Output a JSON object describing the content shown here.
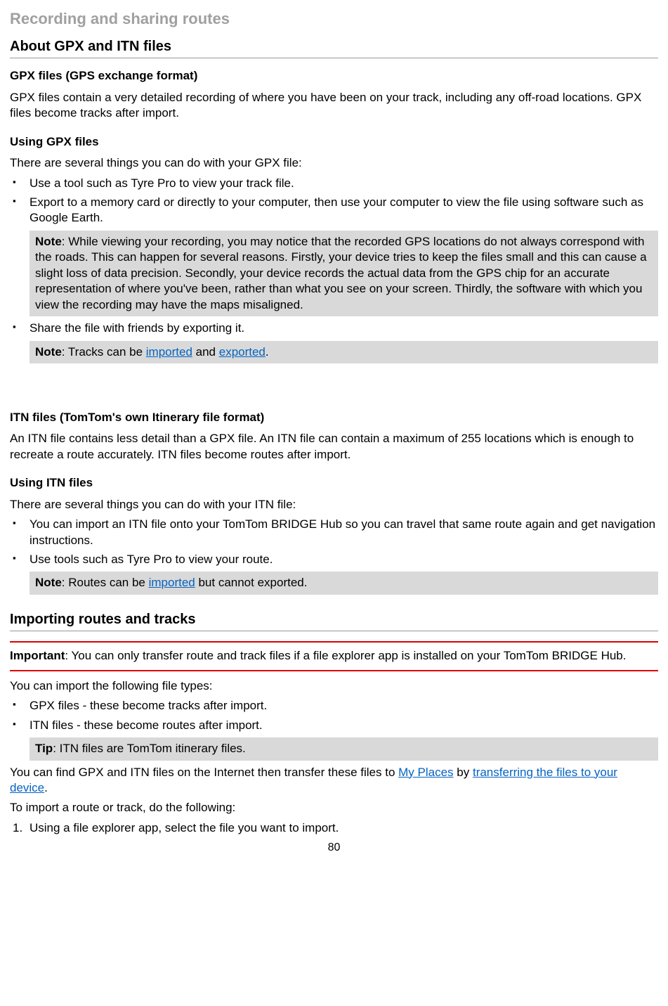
{
  "section_title": "Recording and sharing routes",
  "subsection_about": "About GPX and ITN files",
  "gpx": {
    "title": "GPX files (GPS exchange format)",
    "intro": "GPX files contain a very detailed recording of where you have been on your track, including any off-road locations. GPX files become tracks after import.",
    "using_title": "Using GPX files",
    "using_intro": "There are several things you can do with your GPX file:",
    "bullets": [
      "Use a tool such as Tyre Pro to view your track file.",
      "Export to a memory card or directly to your computer, then use your computer to view the file using software such as Google Earth."
    ],
    "note1_label": "Note",
    "note1": ": While viewing your recording, you may notice that the recorded GPS locations do not always correspond with the roads. This can happen for several reasons. Firstly, your device tries to keep the files small and this can cause a slight loss of data precision. Secondly, your device records the actual data from the GPS chip for an accurate representation of where you've been, rather than what you see on your screen. Thirdly, the software with which you view the recording may have the maps misaligned.",
    "bullet3": "Share the file with friends by exporting it.",
    "note2_label": "Note",
    "note2_pre": ": Tracks can be ",
    "note2_link1": "imported",
    "note2_mid": " and ",
    "note2_link2": "exported",
    "note2_post": "."
  },
  "itn": {
    "title": "ITN files (TomTom's own Itinerary file format)",
    "intro": "An ITN file contains less detail than a GPX file. An ITN file can contain a maximum of 255 locations which is enough to recreate a route accurately. ITN files become routes after import.",
    "using_title": "Using ITN files",
    "using_intro": "There are several things you can do with your ITN file:",
    "bullets": [
      "You can import an ITN file onto your TomTom BRIDGE Hub so you can travel that same route again and get navigation instructions.",
      "Use tools such as Tyre Pro to view your route."
    ],
    "note_label": "Note",
    "note_pre": ": Routes can be ",
    "note_link": "imported",
    "note_post": " but cannot exported."
  },
  "importing": {
    "title": "Importing routes and tracks",
    "important_label": "Important",
    "important_text": ": You can only transfer route and track files if a file explorer app is installed on your TomTom BRIDGE Hub.",
    "intro": "You can import the following file types:",
    "bullets": [
      "GPX files - these become tracks after import.",
      "ITN files - these become routes after import."
    ],
    "tip_label": "Tip",
    "tip_text": ": ITN files are TomTom itinerary files.",
    "para_pre": "You can find GPX and ITN files on the Internet then transfer these files to ",
    "para_link1": "My Places",
    "para_mid": " by ",
    "para_link2": "transferring the files to your device",
    "para_post": ".",
    "steps_intro": "To import a route or track, do the following:",
    "step1_num": "1.",
    "step1": "Using a file explorer app, select the file you want to import."
  },
  "page_number": "80"
}
